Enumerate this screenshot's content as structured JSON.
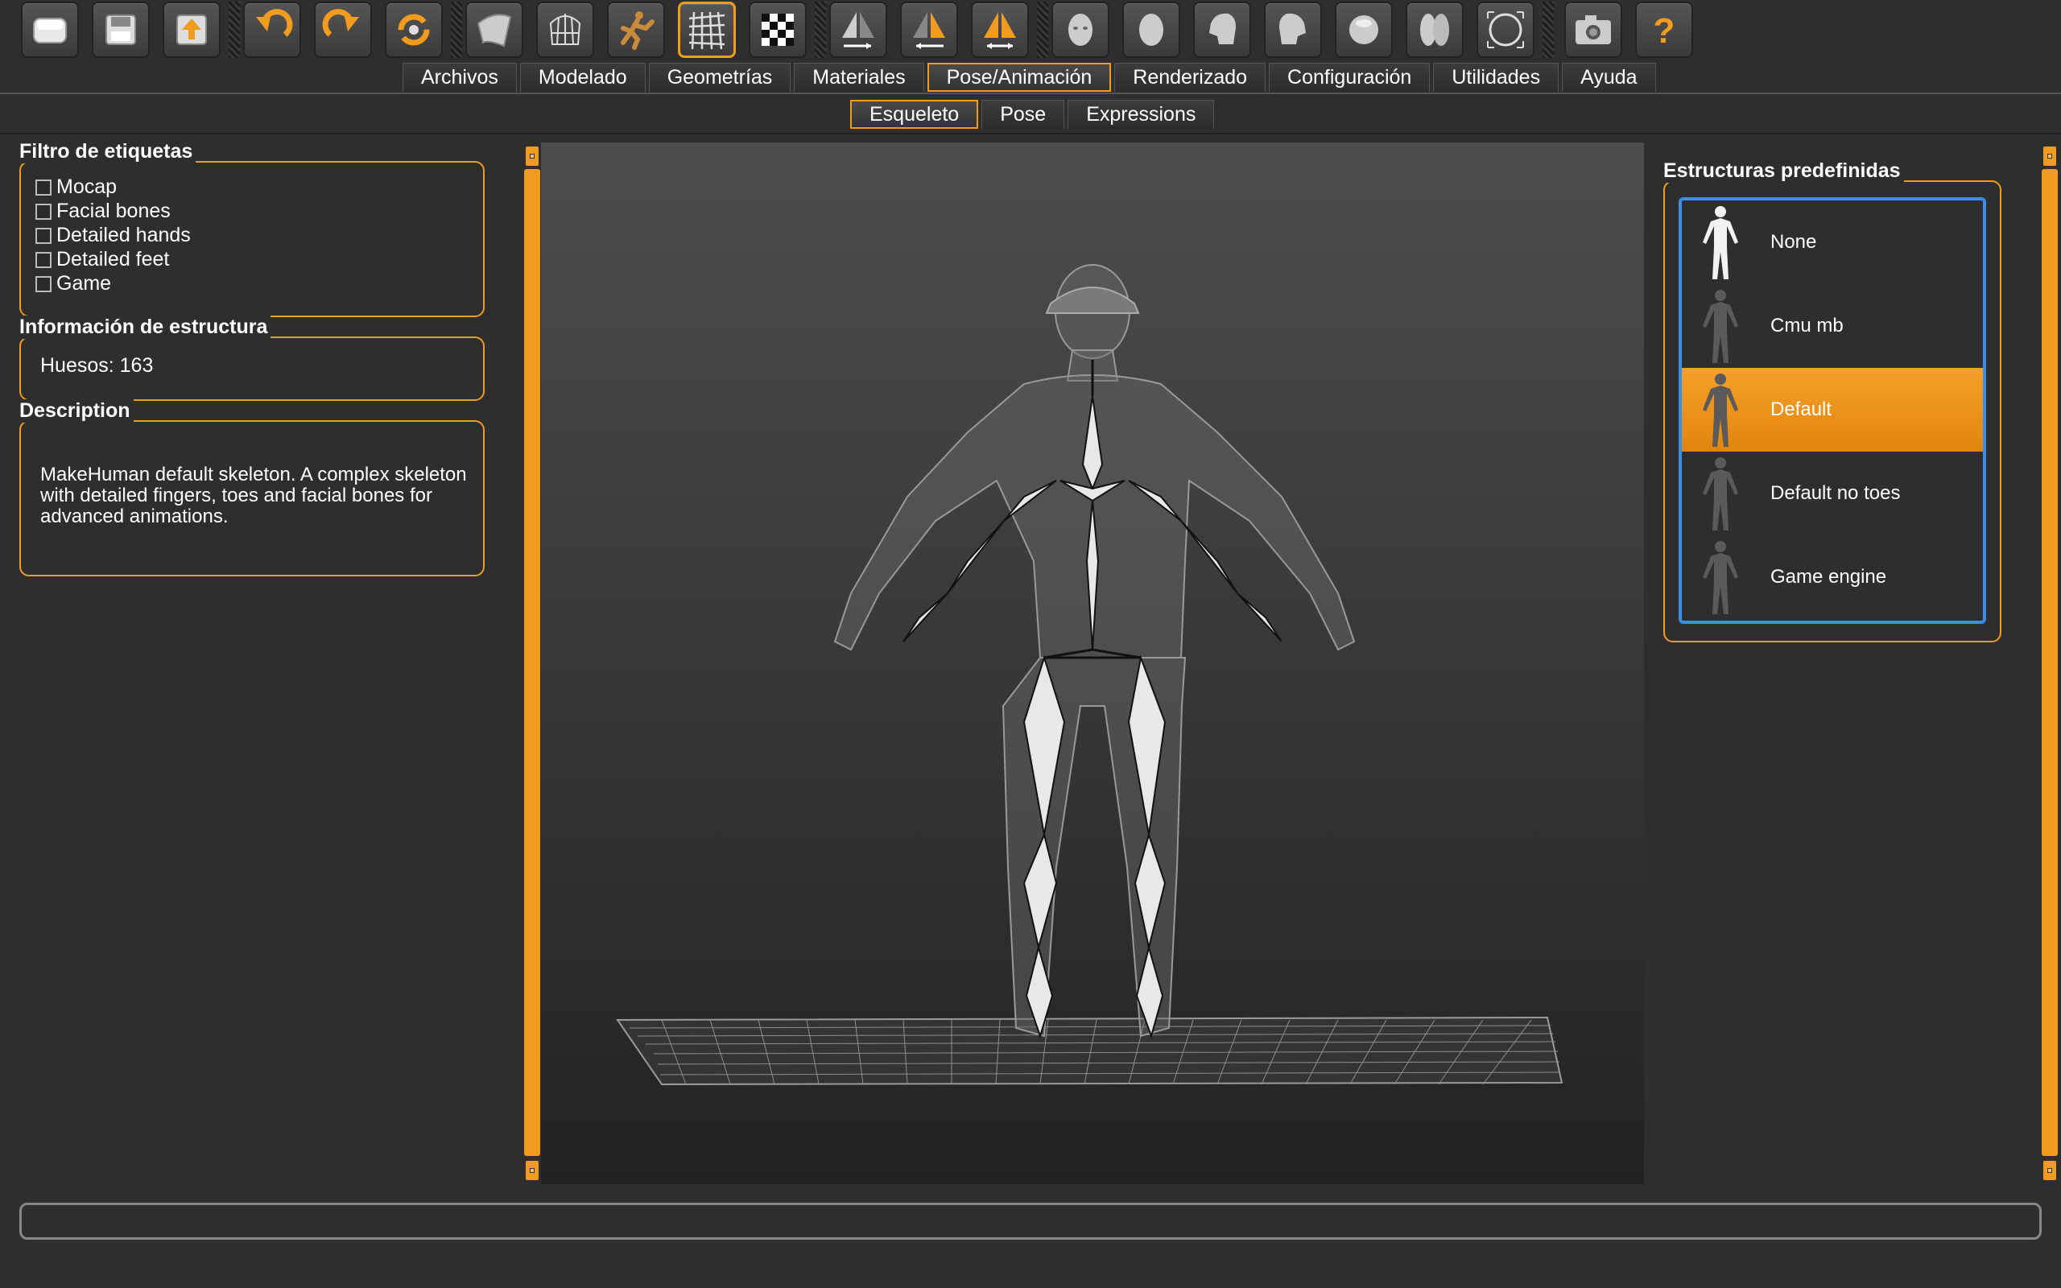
{
  "toolbar": {
    "buttons": [
      {
        "name": "new-icon"
      },
      {
        "name": "save-icon"
      },
      {
        "name": "export-icon"
      },
      {
        "name": "undo-icon"
      },
      {
        "name": "redo-icon"
      },
      {
        "name": "reset-icon"
      },
      {
        "name": "smooth-icon"
      },
      {
        "name": "wireframe-icon"
      },
      {
        "name": "pose-icon"
      },
      {
        "name": "grid-icon",
        "active": true
      },
      {
        "name": "checker-icon"
      },
      {
        "name": "symmetry-right-icon"
      },
      {
        "name": "symmetry-left-icon"
      },
      {
        "name": "symmetry-icon"
      },
      {
        "name": "front-view-icon"
      },
      {
        "name": "back-view-icon"
      },
      {
        "name": "left-view-icon"
      },
      {
        "name": "right-view-icon"
      },
      {
        "name": "top-view-icon"
      },
      {
        "name": "bottom-view-icon"
      },
      {
        "name": "reset-camera-icon"
      },
      {
        "name": "screenshot-icon"
      },
      {
        "name": "help-icon"
      }
    ]
  },
  "main_tabs": [
    "Archivos",
    "Modelado",
    "Geometrías",
    "Materiales",
    "Pose/Animación",
    "Renderizado",
    "Configuración",
    "Utilidades",
    "Ayuda"
  ],
  "main_tab_active": "Pose/Animación",
  "sub_tabs": [
    "Esqueleto",
    "Pose",
    "Expressions"
  ],
  "sub_tab_active": "Esqueleto",
  "left": {
    "filter": {
      "title": "Filtro de etiquetas",
      "items": [
        {
          "label": "Mocap",
          "checked": false
        },
        {
          "label": "Facial bones",
          "checked": false
        },
        {
          "label": "Detailed hands",
          "checked": false
        },
        {
          "label": "Detailed feet",
          "checked": false
        },
        {
          "label": "Game",
          "checked": false
        }
      ]
    },
    "info": {
      "title": "Información de estructura",
      "bones": "Huesos: 163"
    },
    "description": {
      "title": "Description",
      "text": "MakeHuman default skeleton. A complex skeleton with detailed fingers, toes and facial bones for advanced animations."
    }
  },
  "right": {
    "title": "Estructuras predefinidas",
    "items": [
      {
        "label": "None"
      },
      {
        "label": "Cmu mb"
      },
      {
        "label": "Default",
        "selected": true
      },
      {
        "label": "Default no toes"
      },
      {
        "label": "Game engine"
      }
    ]
  },
  "colors": {
    "accent": "#f19b1f",
    "selection_border": "#3d8fe6",
    "background": "#2e2e2e"
  }
}
